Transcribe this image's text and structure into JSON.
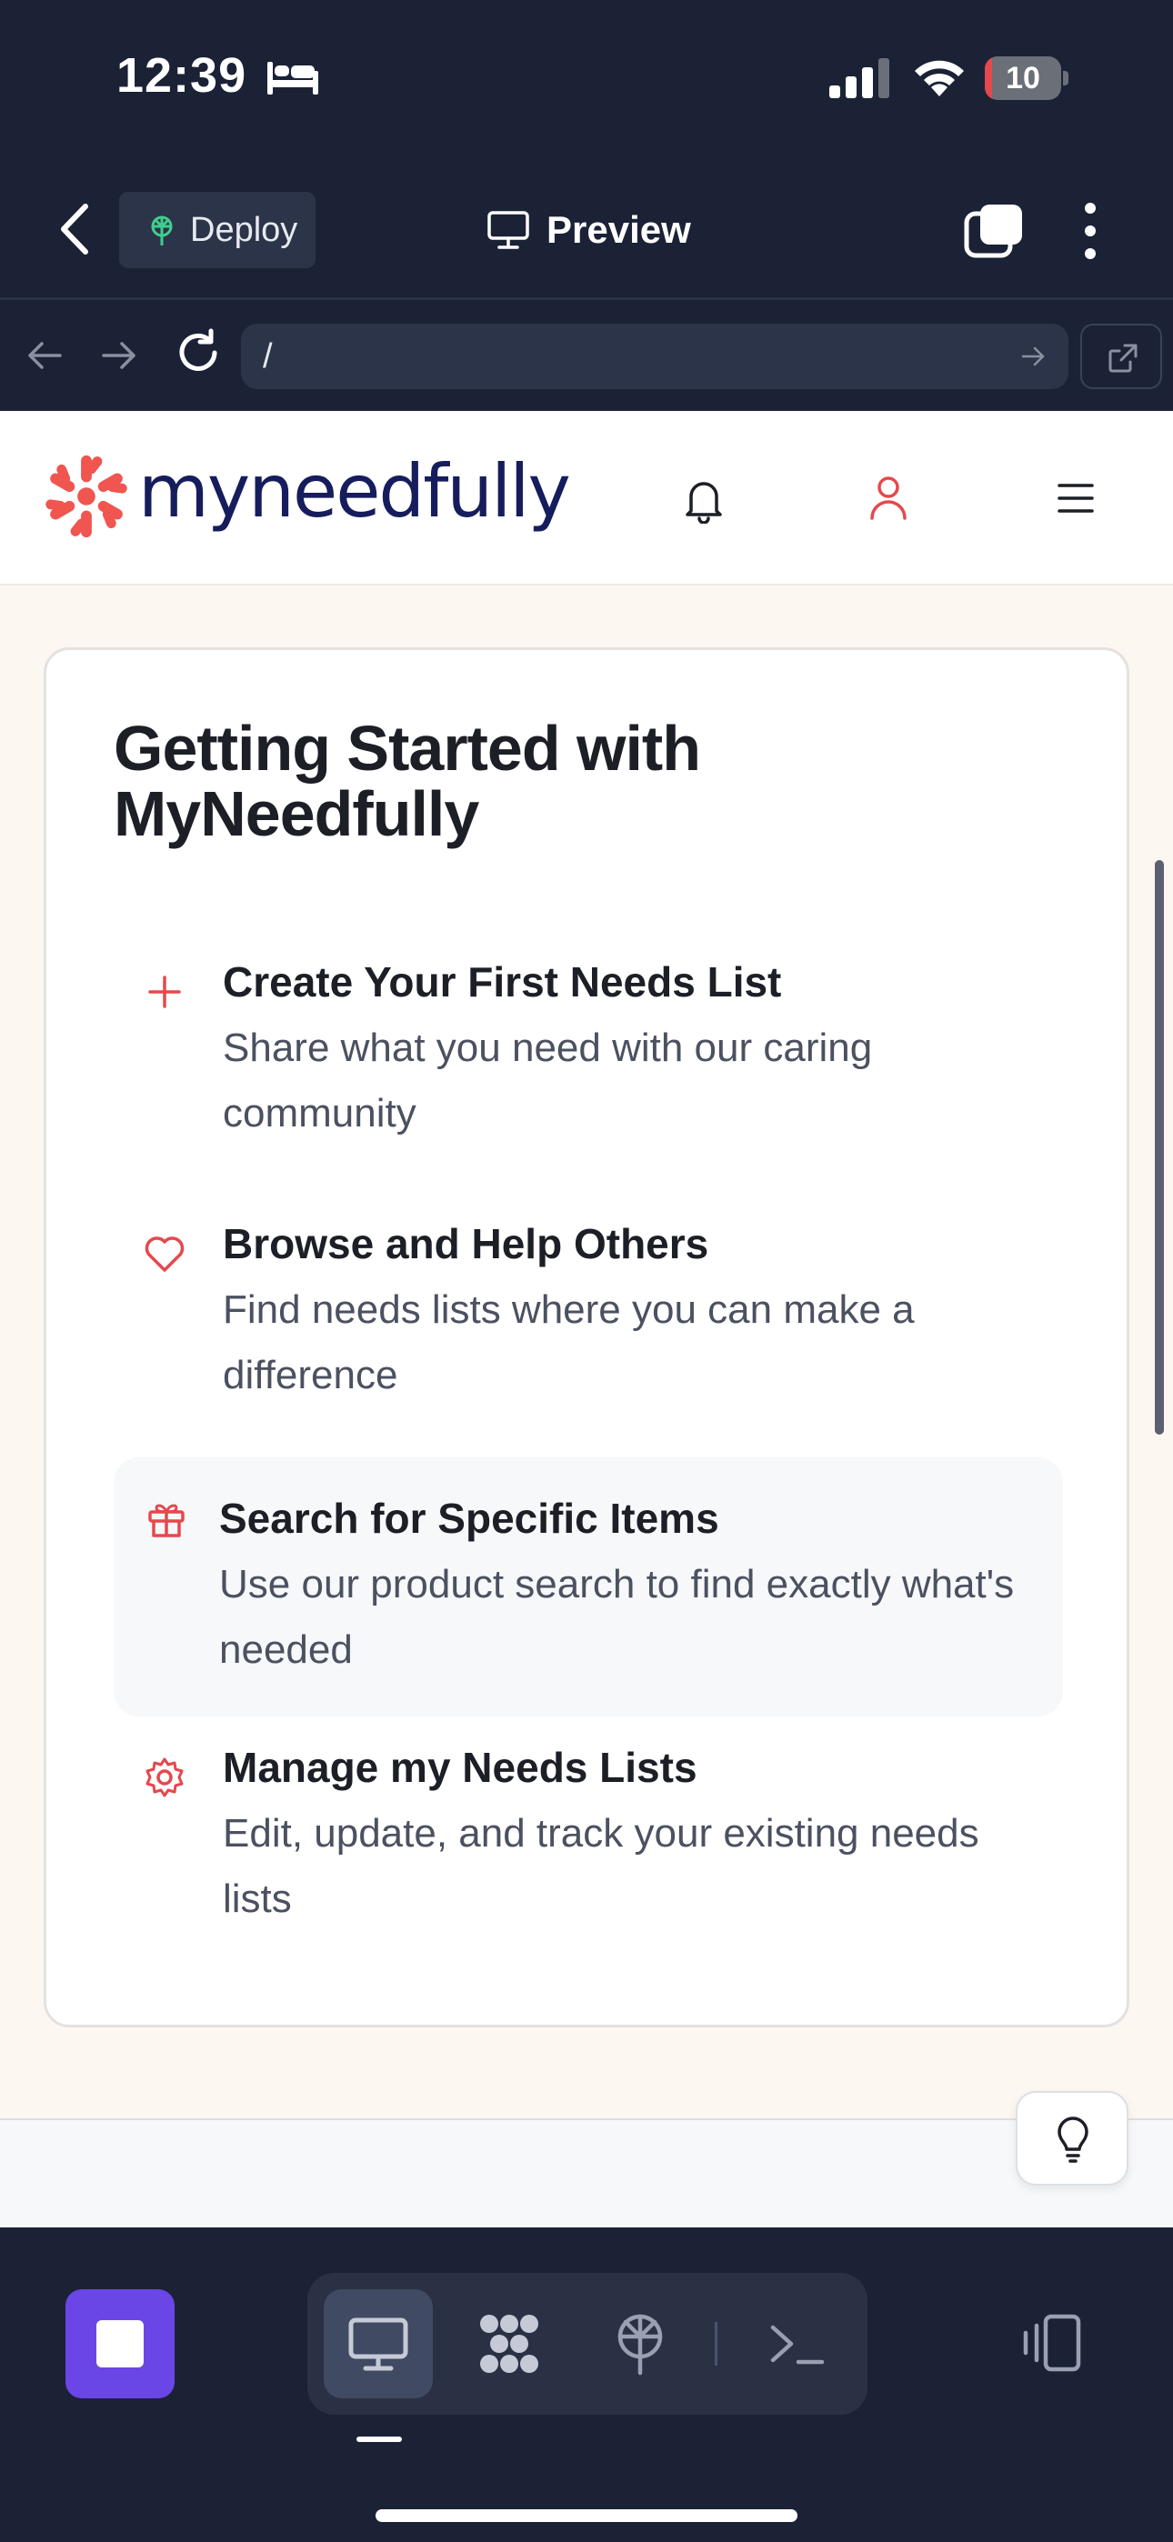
{
  "status_bar": {
    "time": "12:39",
    "battery_level": "10",
    "battery_fraction": 0.1,
    "icons": [
      "bed-icon",
      "signal-icon",
      "wifi-icon",
      "battery-icon"
    ]
  },
  "app_header": {
    "deploy_label": "Deploy",
    "preview_label": "Preview",
    "icons": [
      "back-chevron-icon",
      "deploy-icon",
      "monitor-icon",
      "tabs-icon",
      "more-vertical-icon"
    ]
  },
  "browser": {
    "url": "/",
    "icons": [
      "arrow-left-icon",
      "arrow-right-icon",
      "reload-icon",
      "go-arrow-icon",
      "open-external-icon"
    ]
  },
  "site": {
    "logo_text": "myneedfully",
    "icons": [
      "logo-mark-icon",
      "bell-icon",
      "user-icon",
      "menu-icon"
    ]
  },
  "card": {
    "title": "Getting Started with MyNeedfully",
    "items": [
      {
        "icon": "plus-icon",
        "title": "Create Your First Needs List",
        "description": "Share what you need with our caring community"
      },
      {
        "icon": "heart-icon",
        "title": "Browse and Help Others",
        "description": "Find needs lists where you can make a difference"
      },
      {
        "icon": "gift-icon",
        "title": "Search for Specific Items",
        "description": "Use our product search to find exactly what's needed"
      },
      {
        "icon": "gear-icon",
        "title": "Manage my Needs Lists",
        "description": "Edit, update, and track your existing needs lists"
      }
    ]
  },
  "colors": {
    "accent_red": "#e5484d",
    "brand_navy": "#161d5c",
    "app_dark": "#1b2236",
    "stop_purple": "#6b46e6"
  },
  "bottom_toolbar": {
    "icons": [
      "stop-icon",
      "monitor-icon",
      "apps-icon",
      "deploy-icon",
      "terminal-icon",
      "devices-icon"
    ]
  }
}
